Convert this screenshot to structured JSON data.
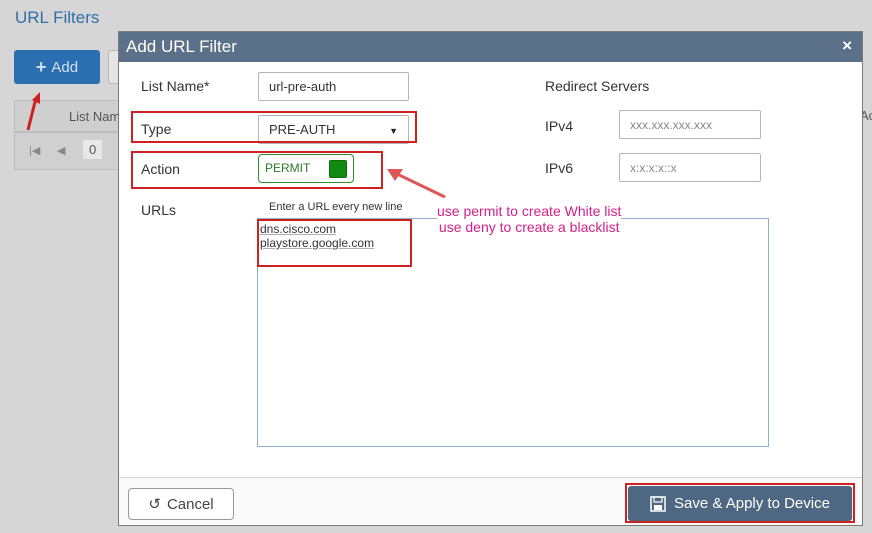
{
  "background": {
    "page_title": "URL Filters",
    "add_label": "Add",
    "table_col": "List Nam",
    "pager_page": "0",
    "right_fragment": "Ac"
  },
  "modal": {
    "title": "Add URL Filter",
    "close": "×",
    "list_name_label": "List Name*",
    "list_name_value": "url-pre-auth",
    "type_label": "Type",
    "type_value": "PRE-AUTH",
    "action_label": "Action",
    "action_value": "PERMIT",
    "urls_label": "URLs",
    "urls_hint": "Enter a URL every new line",
    "urls": [
      "dns.cisco.com",
      "playstore.google.com"
    ],
    "redirect_title": "Redirect Servers",
    "ipv4_label": "IPv4",
    "ipv4_placeholder": "xxx.xxx.xxx.xxx",
    "ipv6_label": "IPv6",
    "ipv6_placeholder": "x:x:x:x::x",
    "cancel_label": "Cancel",
    "save_label": "Save & Apply to Device"
  },
  "annotation": {
    "line1": "use permit  to create White list",
    "line2": "use  deny to create a blacklist"
  },
  "colors": {
    "header": "#5b7189",
    "toggle_on": "#118a11",
    "annotation_red": "#cc2222",
    "annotation_text": "#d21f8a"
  }
}
